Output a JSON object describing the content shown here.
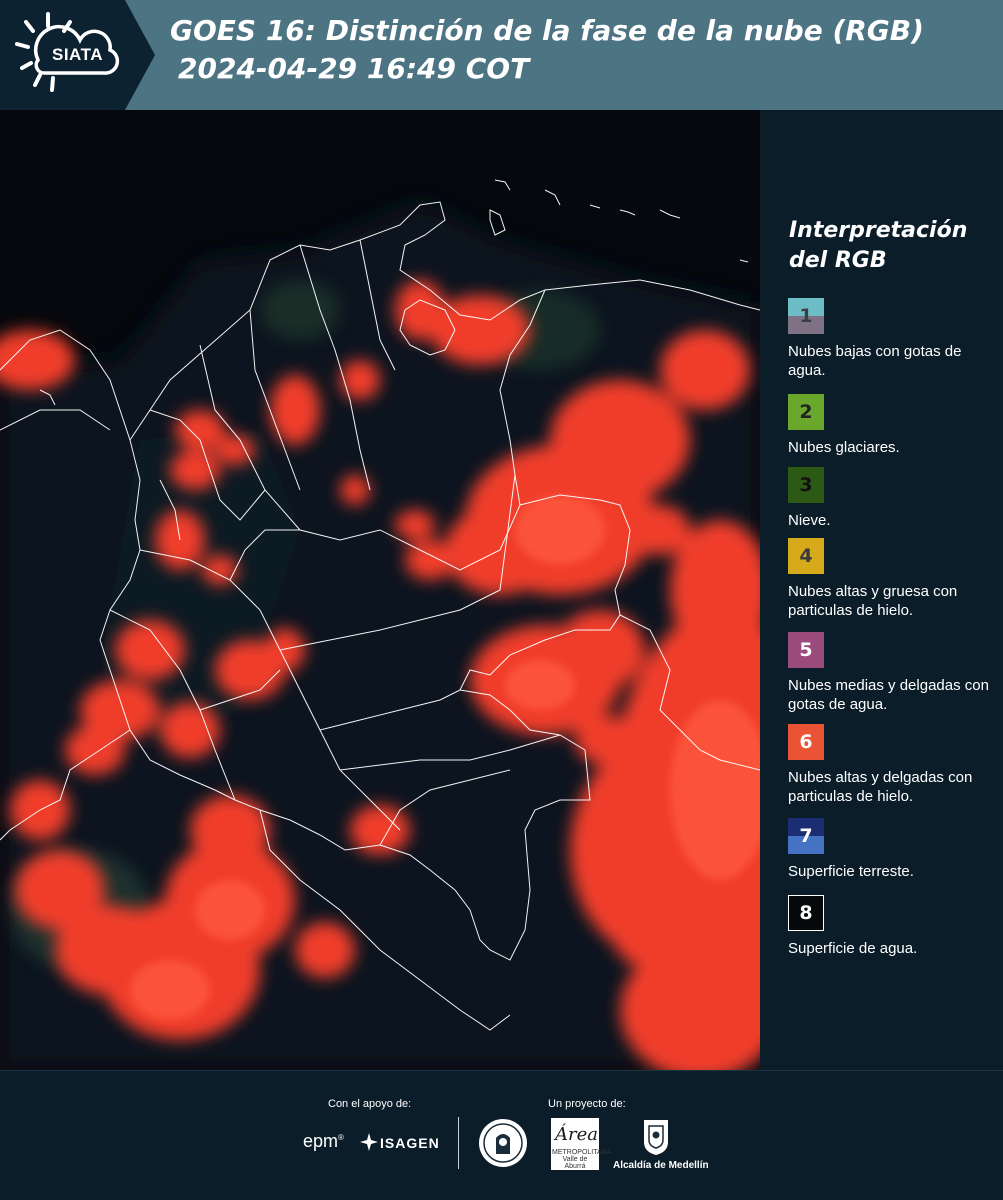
{
  "header": {
    "brand": "SIATA",
    "title_line1": "GOES 16: Distinción de la fase de la nube (RGB)",
    "title_line2": "2024-04-29 16:49 COT"
  },
  "legend": {
    "title": "Interpretación del RGB",
    "items": [
      {
        "number": "1",
        "label": "Nubes bajas con gotas de agua.",
        "colors": [
          "#6cbdc6",
          "#7f7285"
        ],
        "text_color": "#3d3d45"
      },
      {
        "number": "2",
        "label": "Nubes glaciares.",
        "colors": [
          "#69a82d"
        ],
        "text_color": "#232323"
      },
      {
        "number": "3",
        "label": "Nieve.",
        "colors": [
          "#2c5a15"
        ],
        "text_color": "#111111"
      },
      {
        "number": "4",
        "label": "Nubes altas y gruesa con particulas de hielo.",
        "colors": [
          "#d7aa1b"
        ],
        "text_color": "#3a3a3a"
      },
      {
        "number": "5",
        "label": "Nubes medias y delgadas con gotas de agua.",
        "colors": [
          "#9a4b7c"
        ],
        "text_color": "#ffffff"
      },
      {
        "number": "6",
        "label": "Nubes altas y delgadas con particulas de hielo.",
        "colors": [
          "#ea5333"
        ],
        "text_color": "#ffffff"
      },
      {
        "number": "7",
        "label": "Superficie terreste.",
        "colors": [
          "#1b2e73",
          "#4572c2"
        ],
        "text_color": "#ffffff"
      },
      {
        "number": "8",
        "label": "Superficie de agua.",
        "colors": [
          "#05090a"
        ],
        "text_color": "#ffffff",
        "border": "#ffffff"
      }
    ]
  },
  "footer": {
    "support_label": "Con el apoyo de:",
    "project_label": "Un proyecto de:",
    "logos": {
      "epm": "epm",
      "isagen": "ISAGEN",
      "area": "Área",
      "area_caption": "METROPOLITANA Valle de Aburrá",
      "medellin": "Alcaldía de Medellín"
    }
  },
  "colors": {
    "header_bg": "#4d7483",
    "logo_bg": "#0c2231",
    "panel_bg": "#0c1d2a",
    "cloud": "#f03e2c",
    "borders": "#ffffff"
  }
}
